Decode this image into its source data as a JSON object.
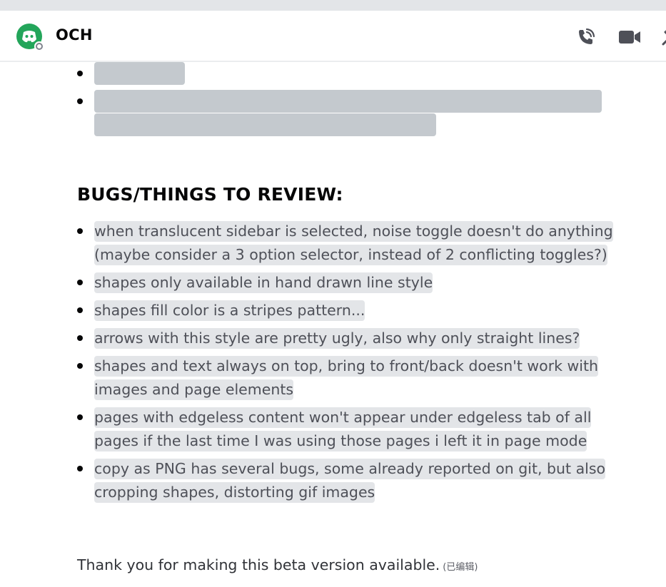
{
  "header": {
    "title": "OCH",
    "icons": [
      "call-icon",
      "video-call-icon",
      "pin-icon"
    ]
  },
  "message": {
    "heading": "BUGS/THINGS TO REVIEW:",
    "bugs": [
      "when translucent sidebar is selected, noise toggle doesn't do anything (maybe consider a 3 option selector, instead of 2 conflicting toggles?)",
      "shapes only available in hand drawn line style",
      "shapes fill color is a stripes pattern...",
      "arrows with this style are pretty ugly, also why only straight lines?",
      "shapes and text always on top, bring to front/back doesn't work with images and page elements",
      "pages with edgeless content won't appear under edgeless tab of all pages if the last time I was using those pages i left it in page mode",
      "copy as PNG has several bugs, some already reported on git, but also cropping shapes, distorting gif images"
    ],
    "closing": "Thank you for making this beta version available.",
    "edited_label": "(已编辑)"
  },
  "colors": {
    "avatar_bg": "#23a55a",
    "spoiler_bg": "#c4c9ce",
    "text_highlight": "#e3e5e8",
    "header_icon": "#4e5058"
  }
}
